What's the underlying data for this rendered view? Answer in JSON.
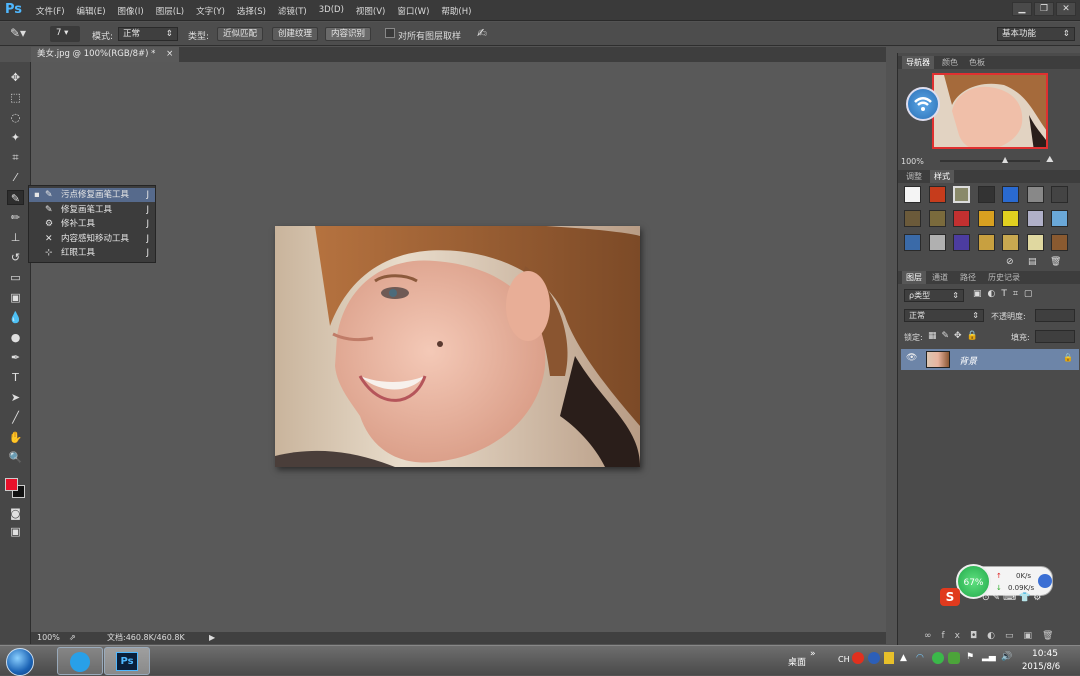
{
  "app": {
    "logo": "Ps",
    "workspace": "基本功能"
  },
  "menu": [
    "文件(F)",
    "编辑(E)",
    "图像(I)",
    "图层(L)",
    "文字(Y)",
    "选择(S)",
    "滤镜(T)",
    "3D(D)",
    "视图(V)",
    "窗口(W)",
    "帮助(H)"
  ],
  "window_buttons": [
    "▁",
    "❐",
    "✕"
  ],
  "options": {
    "brush_size": "7",
    "mode_label": "模式:",
    "mode_value": "正常",
    "type_label": "类型:",
    "type_buttons": [
      "近似匹配",
      "创建纹理",
      "内容识别"
    ],
    "sample_all_label": "对所有图层取样"
  },
  "document": {
    "tab_title": "美女.jpg @ 100%(RGB/8#) *",
    "close": "×"
  },
  "flyout": {
    "items": [
      {
        "label": "污点修复画笔工具",
        "key": "J",
        "icon": "spot-healing-icon",
        "glyph": "✎",
        "active": true
      },
      {
        "label": "修复画笔工具",
        "key": "J",
        "icon": "healing-brush-icon",
        "glyph": "✎",
        "active": false
      },
      {
        "label": "修补工具",
        "key": "J",
        "icon": "patch-icon",
        "glyph": "⚙",
        "active": false
      },
      {
        "label": "内容感知移动工具",
        "key": "J",
        "icon": "content-aware-move-icon",
        "glyph": "✕",
        "active": false
      },
      {
        "label": "红眼工具",
        "key": "J",
        "icon": "red-eye-icon",
        "glyph": "⊹",
        "active": false
      }
    ],
    "bullet": "▪"
  },
  "tools": [
    {
      "name": "move-tool-icon",
      "glyph": "✥"
    },
    {
      "name": "marquee-tool-icon",
      "glyph": "⬚"
    },
    {
      "name": "lasso-tool-icon",
      "glyph": "◌"
    },
    {
      "name": "magic-wand-icon",
      "glyph": "✦"
    },
    {
      "name": "crop-tool-icon",
      "glyph": "⌗"
    },
    {
      "name": "eyedropper-icon",
      "glyph": "⁄"
    },
    {
      "name": "healing-brush-tool-icon",
      "glyph": "✎"
    },
    {
      "name": "brush-tool-icon",
      "glyph": "✏"
    },
    {
      "name": "clone-stamp-icon",
      "glyph": "⊥"
    },
    {
      "name": "history-brush-icon",
      "glyph": "↺"
    },
    {
      "name": "eraser-icon",
      "glyph": "▭"
    },
    {
      "name": "gradient-icon",
      "glyph": "▣"
    },
    {
      "name": "blur-icon",
      "glyph": "💧"
    },
    {
      "name": "dodge-icon",
      "glyph": "●"
    },
    {
      "name": "pen-tool-icon",
      "glyph": "✒"
    },
    {
      "name": "type-tool-icon",
      "glyph": "T"
    },
    {
      "name": "path-select-icon",
      "glyph": "➤"
    },
    {
      "name": "line-tool-icon",
      "glyph": "╱"
    },
    {
      "name": "hand-tool-icon",
      "glyph": "✋"
    },
    {
      "name": "zoom-tool-icon",
      "glyph": "🔍"
    }
  ],
  "colors": {
    "foreground": "#e8102a",
    "background": "#111111"
  },
  "status": {
    "zoom": "100%",
    "doc_info": "文档:460.8K/460.8K"
  },
  "navigator": {
    "tabs": [
      "导航器",
      "颜色",
      "色板"
    ],
    "zoom": "100%"
  },
  "styles_panel": {
    "tabs": [
      "调整",
      "样式"
    ]
  },
  "layers_panel": {
    "tabs": [
      "图层",
      "通道",
      "路径",
      "历史记录"
    ],
    "kind": "ρ类型",
    "blend": "正常",
    "opacity_label": "不透明度:",
    "lock_label": "锁定:",
    "fill_label": "填充:",
    "layer_name": "背景"
  },
  "taskbar": {
    "desktop_label": "桌面",
    "ime": "CH",
    "time": "10:45",
    "date": "2015/8/6"
  },
  "net_widget": {
    "percent": "67%",
    "up": "0K/s",
    "down": "0.09K/s"
  }
}
